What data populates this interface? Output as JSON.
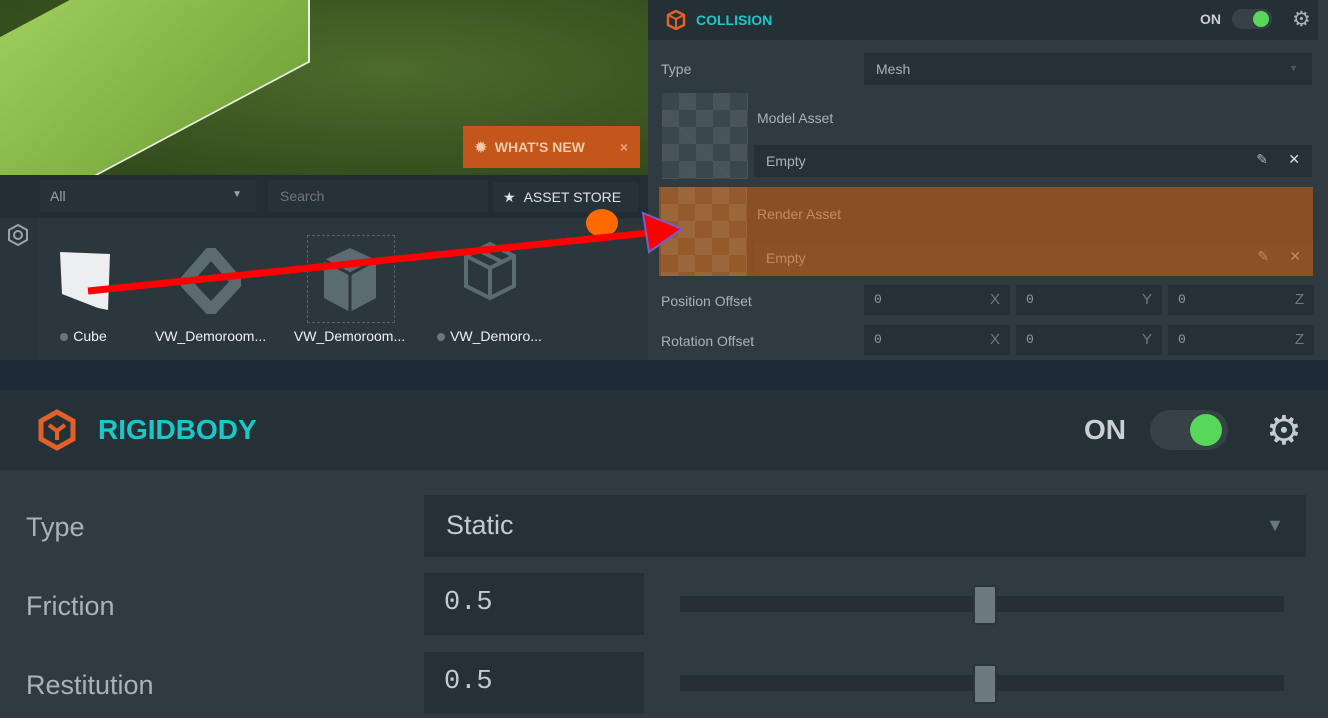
{
  "viewport": {
    "whats_new_label": "WHAT'S NEW",
    "close": "×"
  },
  "assets_panel": {
    "filter": "All",
    "search_placeholder": "Search",
    "asset_store_label": "ASSET STORE",
    "items": [
      {
        "name": "Cube",
        "icon": "cube-thumbnail"
      },
      {
        "name": "VW_Demoroom...",
        "icon": "template-diamond-icon"
      },
      {
        "name": "VW_Demoroom...",
        "icon": "model-cube-icon"
      },
      {
        "name": "VW_Demoro...",
        "icon": "box-outline-icon"
      }
    ]
  },
  "collision": {
    "title": "COLLISION",
    "toggle_label": "ON",
    "enabled": true,
    "type_label": "Type",
    "type_value": "Mesh",
    "model_asset_label": "Model Asset",
    "model_asset_value": "Empty",
    "render_asset_label": "Render Asset",
    "render_asset_value": "Empty",
    "position_offset_label": "Position Offset",
    "rotation_offset_label": "Rotation Offset",
    "position_offset": [
      "0",
      "0",
      "0"
    ],
    "rotation_offset": [
      "0",
      "0",
      "0"
    ],
    "axes": [
      "X",
      "Y",
      "Z"
    ]
  },
  "rigidbody": {
    "title": "RIGIDBODY",
    "toggle_label": "ON",
    "enabled": true,
    "type_label": "Type",
    "type_value": "Static",
    "friction_label": "Friction",
    "friction_value": "0.5",
    "restitution_label": "Restitution",
    "restitution_value": "0.5"
  },
  "colors": {
    "accent": "#1bc8c8",
    "highlight": "#8a4f24",
    "toggle_on": "#58d85a",
    "arrow": "#ff0000"
  }
}
